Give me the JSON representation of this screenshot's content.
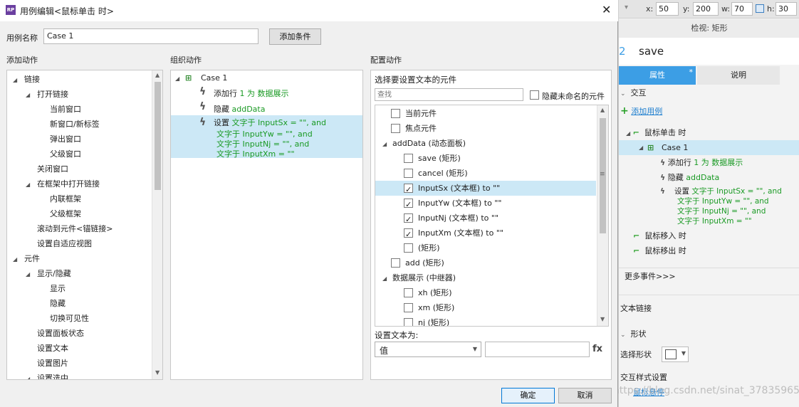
{
  "dialog": {
    "title": "用例编辑<鼠标单击 时>",
    "close_glyph": "✕",
    "case_name_label": "用例名称",
    "case_name_value": "Case 1",
    "add_condition_button": "添加条件",
    "col_add_actions": "添加动作",
    "col_organize_actions": "组织动作",
    "col_configure_actions": "配置动作",
    "ok_button": "确定",
    "cancel_button": "取消"
  },
  "add_actions_tree": [
    {
      "label": "链接",
      "level": 0,
      "expanded": true
    },
    {
      "label": "打开链接",
      "level": 1,
      "expanded": true
    },
    {
      "label": "当前窗口",
      "level": 2
    },
    {
      "label": "新窗口/新标签",
      "level": 2
    },
    {
      "label": "弹出窗口",
      "level": 2
    },
    {
      "label": "父级窗口",
      "level": 2
    },
    {
      "label": "关闭窗口",
      "level": 1
    },
    {
      "label": "在框架中打开链接",
      "level": 1,
      "expanded": true
    },
    {
      "label": "内联框架",
      "level": 2
    },
    {
      "label": "父级框架",
      "level": 2
    },
    {
      "label": "滚动到元件<锚链接>",
      "level": 1
    },
    {
      "label": "设置自适应视图",
      "level": 1
    },
    {
      "label": "元件",
      "level": 0,
      "expanded": true
    },
    {
      "label": "显示/隐藏",
      "level": 1,
      "expanded": true
    },
    {
      "label": "显示",
      "level": 2
    },
    {
      "label": "隐藏",
      "level": 2
    },
    {
      "label": "切换可见性",
      "level": 2
    },
    {
      "label": "设置面板状态",
      "level": 1
    },
    {
      "label": "设置文本",
      "level": 1
    },
    {
      "label": "设置图片",
      "level": 1
    },
    {
      "label": "设置选中",
      "level": 1,
      "expanded": true
    }
  ],
  "organize": {
    "case_label": "Case 1",
    "actions": [
      {
        "verb": "添加行",
        "detail": "1 为 数据展示"
      },
      {
        "verb": "隐藏",
        "detail": "addData"
      },
      {
        "verb": "设置",
        "lines": [
          "文字于 InputSx = \"\", and",
          "文字于 InputYw = \"\", and",
          "文字于 InputNj = \"\", and",
          "文字于 InputXm = \"\""
        ]
      }
    ]
  },
  "configure": {
    "heading": "选择要设置文本的元件",
    "search_placeholder": "查找",
    "hide_unnamed_label": "隐藏未命名的元件",
    "widgets": [
      {
        "label": "当前元件",
        "level": 1,
        "checked": false
      },
      {
        "label": "焦点元件",
        "level": 1,
        "checked": false
      },
      {
        "label": "addData (动态面板)",
        "level": 0,
        "group": true
      },
      {
        "label": "save (矩形)",
        "level": 2,
        "checked": false
      },
      {
        "label": "cancel (矩形)",
        "level": 2,
        "checked": false
      },
      {
        "label": "InputSx (文本框) to \"\"",
        "level": 2,
        "checked": true,
        "selected": true
      },
      {
        "label": "InputYw (文本框) to \"\"",
        "level": 2,
        "checked": true
      },
      {
        "label": "InputNj (文本框) to \"\"",
        "level": 2,
        "checked": true
      },
      {
        "label": "InputXm (文本框) to \"\"",
        "level": 2,
        "checked": true
      },
      {
        "label": "(矩形)",
        "level": 2,
        "checked": false
      },
      {
        "label": "add (矩形)",
        "level": 1,
        "checked": false
      },
      {
        "label": "数据展示 (中继器)",
        "level": 0,
        "group": true
      },
      {
        "label": "xh (矩形)",
        "level": 2,
        "checked": false
      },
      {
        "label": "xm (矩形)",
        "level": 2,
        "checked": false
      },
      {
        "label": "nj (矩形)",
        "level": 2,
        "checked": false
      }
    ],
    "set_text_label": "设置文本为:",
    "set_text_type": "值",
    "set_text_value": "",
    "fx_label": "fx"
  },
  "inspector": {
    "x_label": "x:",
    "x_value": "50",
    "y_label": "y:",
    "y_value": "200",
    "w_label": "w:",
    "w_value": "70",
    "h_label": "h:",
    "h_value": "30",
    "panel_title": "检视: 矩形",
    "widget_num": "2",
    "widget_name": "save",
    "tab_properties": "属性",
    "tab_properties_marker": "*",
    "tab_notes": "说明",
    "section_interaction": "交互",
    "add_case_link": "添加用例",
    "event_click": "鼠标单击 时",
    "case_label": "Case 1",
    "actions": [
      {
        "verb": "添加行",
        "detail": "1 为 数据展示"
      },
      {
        "verb": "隐藏",
        "detail": "addData"
      },
      {
        "verb": "设置",
        "lines": [
          "文字于 InputSx = \"\", and",
          "文字于 InputYw = \"\", and",
          "文字于 InputNj = \"\", and",
          "文字于 InputXm = \"\""
        ]
      }
    ],
    "event_mouse_enter": "鼠标移入 时",
    "event_mouse_leave": "鼠标移出 时",
    "more_events": "更多事件>>>",
    "text_link": "文本链接",
    "shape_section": "形状",
    "select_shape": "选择形状",
    "interaction_style": "交互样式设置",
    "hover_link": "鼠标悬停",
    "watermark": "https://blog.csdn.net/sinat_37835965"
  },
  "colors": {
    "accent": "#3c9ee5",
    "selection": "#cce8f6",
    "green_text": "#1a9a24"
  }
}
